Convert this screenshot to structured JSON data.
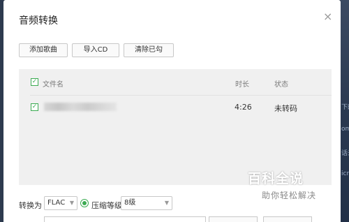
{
  "dialog": {
    "title": "音频转换",
    "close": "×"
  },
  "toolbar": {
    "add_song": "添加歌曲",
    "import_cd": "导入CD",
    "clear_checked": "清除已勾"
  },
  "table": {
    "headers": {
      "filename": "文件名",
      "duration": "时长",
      "status": "状态"
    },
    "rows": [
      {
        "filename": "",
        "duration": "4:26",
        "status": "未转码",
        "checked": true
      }
    ]
  },
  "convert": {
    "convert_to_label": "转换为",
    "format": "FLAC",
    "compression_label": "压缩等级",
    "compression_level": "8级"
  },
  "watermark": {
    "line1": "百科全说",
    "line2": "助你轻松解决"
  },
  "background": {
    "fragments": [
      "下的",
      "om",
      "话去",
      "icr"
    ]
  },
  "colors": {
    "accent": "#3cab52",
    "panel": "#f0f0f0"
  }
}
